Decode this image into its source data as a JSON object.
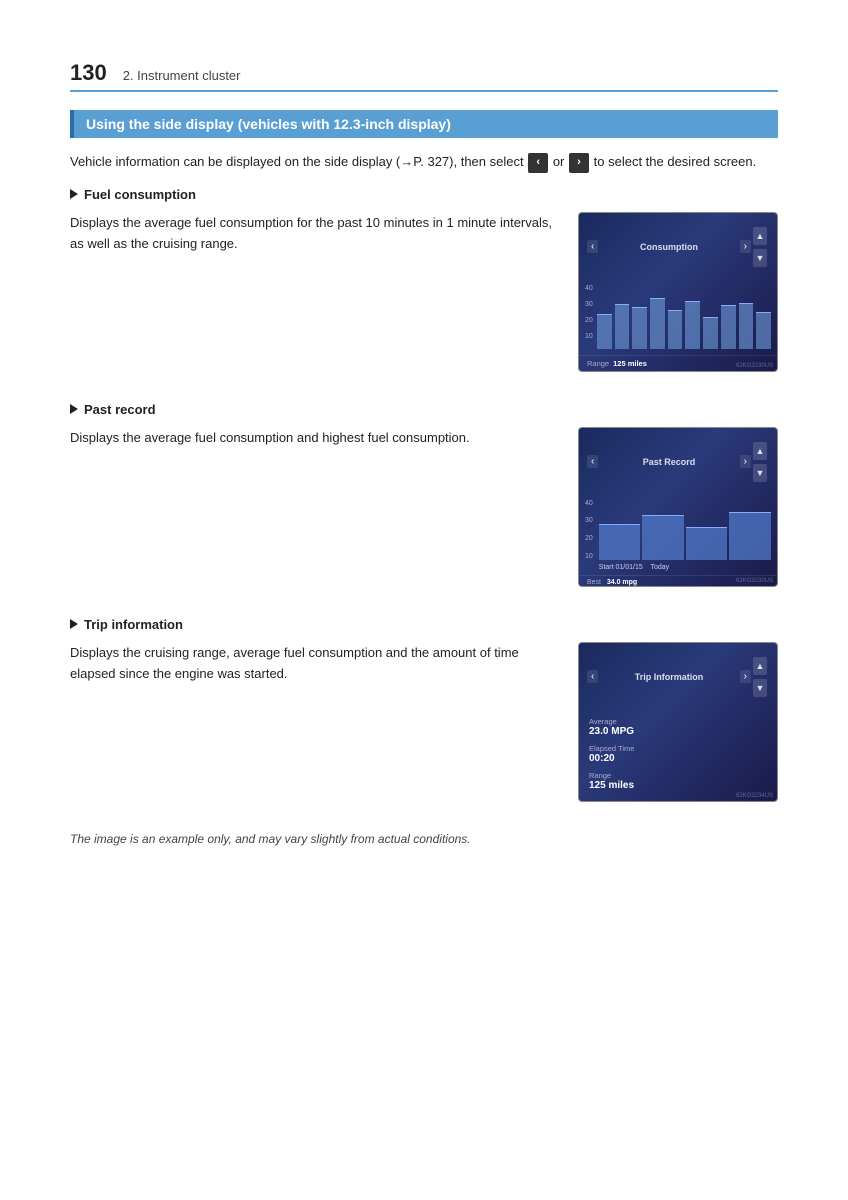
{
  "header": {
    "page_number": "130",
    "chapter_title": "2. Instrument cluster"
  },
  "section": {
    "heading": "Using the side display (vehicles with 12.3-inch display)"
  },
  "intro": {
    "text_before": "Vehicle information can be displayed on the side display (→P. 327), then select",
    "btn_left": "‹",
    "btn_right": "›",
    "text_after": "to select the desired screen."
  },
  "subsections": [
    {
      "id": "fuel-consumption",
      "label": "Fuel consumption",
      "description": "Displays the average fuel consumption for the past 10 minutes in 1 minute intervals, as well as the cruising range.",
      "screen": {
        "title": "Consumption",
        "y_axis": [
          "40",
          "30",
          "20",
          "10"
        ],
        "bars": [
          55,
          70,
          65,
          80,
          60,
          75,
          50,
          68,
          72,
          58
        ],
        "footer_label": "Range",
        "footer_value": "125 miles",
        "watermark": "62KG3230US"
      }
    },
    {
      "id": "past-record",
      "label": "Past record",
      "description": "Displays the average fuel consumption and highest fuel consumption.",
      "screen": {
        "title": "Past Record",
        "y_axis": [
          "40",
          "30",
          "20",
          "10"
        ],
        "bars": [
          60,
          75,
          55,
          80
        ],
        "info_start": "Start  01/01/15",
        "info_today": "Today",
        "footer_label": "Best",
        "footer_value": "34.0 mpg",
        "watermark": "62KG3230US"
      }
    },
    {
      "id": "trip-information",
      "label": "Trip information",
      "description": "Displays the cruising range, average fuel consumption and the amount of time elapsed since the engine was started.",
      "screen": {
        "title": "Trip Information",
        "items": [
          {
            "label": "Average",
            "value": "23.0 MPG"
          },
          {
            "label": "Elapsed Time",
            "value": "00:20"
          },
          {
            "label": "Range",
            "value": "125 miles"
          }
        ],
        "watermark": "62KG3234US"
      }
    }
  ],
  "caption": "The image is an example only, and may vary slightly from actual conditions."
}
